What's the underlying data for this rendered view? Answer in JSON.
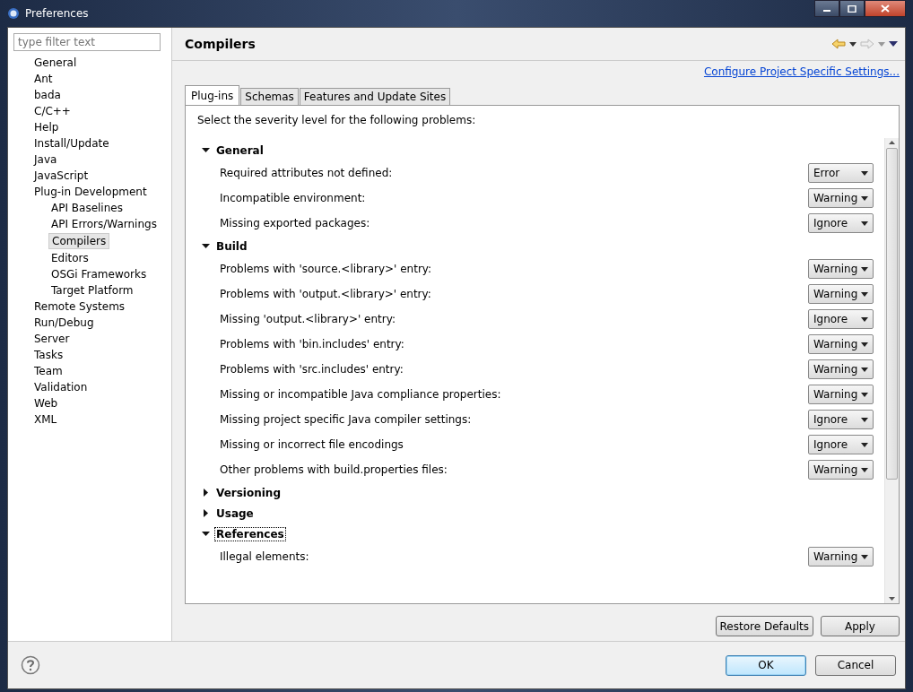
{
  "window": {
    "title": "Preferences"
  },
  "filter": {
    "placeholder": "type filter text"
  },
  "tree": [
    {
      "label": "General",
      "selected": false
    },
    {
      "label": "Ant",
      "selected": false
    },
    {
      "label": "bada",
      "selected": false
    },
    {
      "label": "C/C++",
      "selected": false
    },
    {
      "label": "Help",
      "selected": false
    },
    {
      "label": "Install/Update",
      "selected": false
    },
    {
      "label": "Java",
      "selected": false
    },
    {
      "label": "JavaScript",
      "selected": false
    },
    {
      "label": "Plug-in Development",
      "selected": false,
      "children": [
        {
          "label": "API Baselines",
          "selected": false
        },
        {
          "label": "API Errors/Warnings",
          "selected": false
        },
        {
          "label": "Compilers",
          "selected": true
        },
        {
          "label": "Editors",
          "selected": false
        },
        {
          "label": "OSGi Frameworks",
          "selected": false
        },
        {
          "label": "Target Platform",
          "selected": false
        }
      ]
    },
    {
      "label": "Remote Systems",
      "selected": false
    },
    {
      "label": "Run/Debug",
      "selected": false
    },
    {
      "label": "Server",
      "selected": false
    },
    {
      "label": "Tasks",
      "selected": false
    },
    {
      "label": "Team",
      "selected": false
    },
    {
      "label": "Validation",
      "selected": false
    },
    {
      "label": "Web",
      "selected": false
    },
    {
      "label": "XML",
      "selected": false
    }
  ],
  "page": {
    "title": "Compilers",
    "link": "Configure Project Specific Settings..."
  },
  "tabs": [
    {
      "label": "Plug-ins",
      "selected": true
    },
    {
      "label": "Schemas",
      "selected": false
    },
    {
      "label": "Features and Update Sites",
      "selected": false
    }
  ],
  "intro": "Select the severity level for the following problems:",
  "sections": [
    {
      "title": "General",
      "expanded": true,
      "focused": false,
      "items": [
        {
          "label": "Required attributes not defined:",
          "value": "Error"
        },
        {
          "label": "Incompatible environment:",
          "value": "Warning"
        },
        {
          "label": "Missing exported packages:",
          "value": "Ignore"
        }
      ]
    },
    {
      "title": "Build",
      "expanded": true,
      "focused": false,
      "items": [
        {
          "label": "Problems with 'source.<library>' entry:",
          "value": "Warning"
        },
        {
          "label": "Problems with 'output.<library>' entry:",
          "value": "Warning"
        },
        {
          "label": "Missing 'output.<library>' entry:",
          "value": "Ignore"
        },
        {
          "label": "Problems with 'bin.includes' entry:",
          "value": "Warning"
        },
        {
          "label": "Problems with 'src.includes' entry:",
          "value": "Warning"
        },
        {
          "label": "Missing or incompatible Java compliance properties:",
          "value": "Warning"
        },
        {
          "label": "Missing project specific Java compiler settings:",
          "value": "Ignore"
        },
        {
          "label": "Missing or incorrect file encodings",
          "value": "Ignore"
        },
        {
          "label": "Other problems with build.properties files:",
          "value": "Warning"
        }
      ]
    },
    {
      "title": "Versioning",
      "expanded": false,
      "focused": false
    },
    {
      "title": "Usage",
      "expanded": false,
      "focused": false
    },
    {
      "title": "References",
      "expanded": true,
      "focused": true,
      "items": [
        {
          "label": "Illegal elements:",
          "value": "Warning"
        }
      ]
    }
  ],
  "page_buttons": [
    "Restore Defaults",
    "Apply"
  ],
  "dialog_buttons": [
    {
      "label": "OK",
      "default": true
    },
    {
      "label": "Cancel",
      "default": false
    }
  ]
}
